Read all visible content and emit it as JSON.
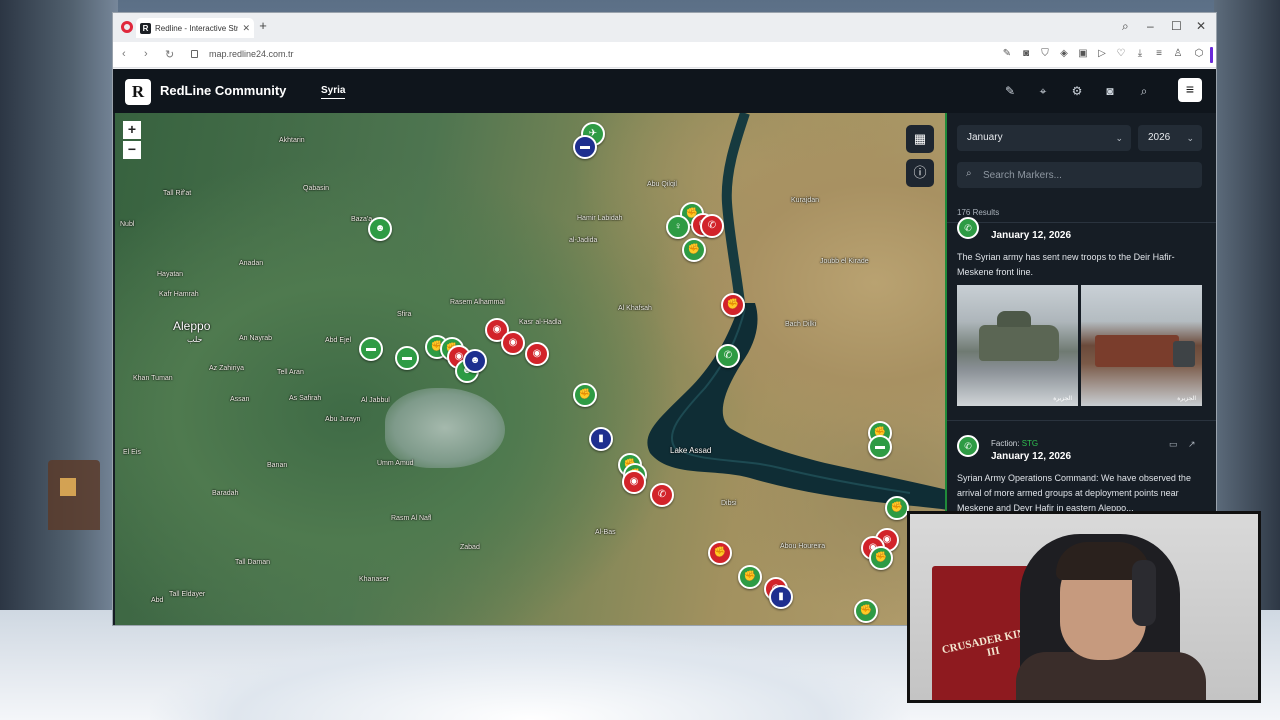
{
  "browser": {
    "tab_title": "Redline - Interactive Strat",
    "url": "map.redline24.com.tr"
  },
  "site": {
    "brand_initial": "R",
    "brand_name": "RedLine Community",
    "nav_tab": "Syria"
  },
  "map": {
    "zoom_in": "+",
    "zoom_out": "−",
    "labels": {
      "aleppo": "Aleppo",
      "aleppo_ar": "حلب",
      "lake_assad": "Lake Assad",
      "akhtarin": "Akhtarin",
      "tall_rifat": "Tall Rif'at",
      "qabasin": "Qabasin",
      "baza": "Baza'a",
      "abu_qilqil": "Abu Qilqil",
      "hamir_labidah": "Hamir Labidah",
      "al_jadida": "al-Jadida",
      "kurajdan": "Kurajdan",
      "joubb_el_kirade": "Joubb el Kirade",
      "bach_dilki": "Bach Dilki",
      "rasem_alhammal": "Rasem Alhammal",
      "kasr_al_hadla": "Kasr al-Hadla",
      "al_khafsah": "Al Khafsah",
      "al_jabbul": "Al Jabbul",
      "abu_jurayn": "Abu Jurayn",
      "umm_amud": "Umm Amud",
      "banan": "Banan",
      "baradah": "Baradah",
      "rasm_al_nafl": "Rasm Al Nafl",
      "zabad": "Zabad",
      "khanaser": "Khanaser",
      "tall_eldayer": "Tall Eldayer",
      "al_bas": "Al-Bas",
      "dibsi": "Dibsi",
      "abou_houreira": "Abou Houreira",
      "as_safirah": "As Safirah",
      "tall_daman": "Tall Daman",
      "az_zahiriya": "Az Zahiriya",
      "khan_turan": "Khan Tuman",
      "hayatan": "Hayatan",
      "kafr_hamrah": "Kafr Hamrah",
      "an_nayrab": "An Nayrab",
      "assan": "Assan",
      "el_eis": "El Eis",
      "nubl": "Nubl",
      "anadan": "Anadan",
      "aabd": "Abd",
      "tell_aran": "Tell Aran",
      "sfira": "Sfira",
      "abd_ejel": "Abd Ejel"
    }
  },
  "panel": {
    "month": "January",
    "year": "2026",
    "search_placeholder": "Search Markers...",
    "results": "176 Results",
    "card1": {
      "date": "January 12, 2026",
      "text": "The Syrian army has sent new troops to the Deir Hafir-Meskene front line.",
      "watermark": "الجزيرة"
    },
    "card2": {
      "faction_label": "Faction:",
      "faction_value": "STG",
      "date": "January 12, 2026",
      "text": "Syrian Army Operations Command: We have observed the arrival of more armed groups at deployment points near Meskene and Deyr Hafir in eastern Aleppo..."
    }
  },
  "webcam": {
    "banner_text": "CRUSADER KINGS III"
  },
  "colors": {
    "faction_green": "#2e9b44",
    "faction_red": "#d2232a",
    "faction_blue": "#1e2f8f",
    "brand_purple": "#6a29d8"
  }
}
